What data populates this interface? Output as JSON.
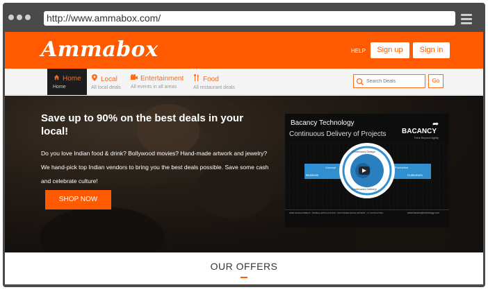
{
  "browser": {
    "url": "http://www.ammabox.com/"
  },
  "header": {
    "logo": "Ammabox",
    "help": "HELP",
    "signup": "Sign up",
    "signin": "Sign in"
  },
  "nav": {
    "items": [
      {
        "label": "Home",
        "sub": "Home",
        "icon": "home-icon"
      },
      {
        "label": "Local",
        "sub": "All local deals",
        "icon": "map-pin-icon"
      },
      {
        "label": "Entertainment",
        "sub": "All events in all areas",
        "icon": "film-icon"
      },
      {
        "label": "Food",
        "sub": "All restaurant deals",
        "icon": "cutlery-icon"
      }
    ],
    "search_placeholder": "Search Deals",
    "go": "Go"
  },
  "hero": {
    "title": "Save up to 90% on the best deals in your local!",
    "text1": "Do you love Indian food & drink? Bollywood movies? Hand-made artwork and jewelry?",
    "text2": "We hand-pick top Indian vendors to bring you the best deals possible. Save some cash and celebrate culture!",
    "cta": "SHOP NOW"
  },
  "video": {
    "channel": "Bacancy Technology",
    "subtitle": "Continuous Delivery of Projects",
    "brand": "BACANCY",
    "brand_tag": "Think Beyond Agility",
    "labels": {
      "concept": "Concept",
      "business": "Business",
      "production": "Production",
      "customers": "Customers",
      "design": "Continuous Design",
      "delivery": "Continuous Delivery",
      "product": "Product"
    },
    "footer_left": "WEB DEVELOPMENT  •  MOBILE APPLICATIONS  •  SOFTWARE DEVELOPMENT  •  IT CONSULTING",
    "footer_right": "www.bacancytechnology.com"
  },
  "offers": {
    "title": "OUR OFFERS"
  },
  "colors": {
    "brand": "#ff5a00",
    "chrome": "#4a4a4a",
    "nav_active": "#1d1d1d"
  }
}
